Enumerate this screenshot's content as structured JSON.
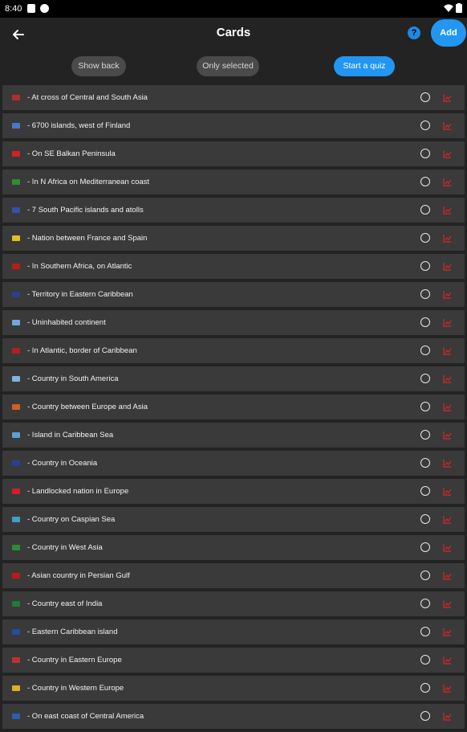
{
  "status": {
    "time": "8:40"
  },
  "header": {
    "title": "Cards",
    "help_label": "?",
    "add_label": "Add"
  },
  "chips": {
    "show_back": "Show back",
    "only_selected": "Only selected",
    "start_quiz": "Start a quiz"
  },
  "colors": {
    "accent": "#2196f3",
    "row_bg": "#3a3a3a",
    "page_bg": "#232323",
    "trend_icon": "#c62828"
  },
  "cards": [
    {
      "text": "- At cross of Central and South Asia",
      "flag_color": "#b02e2e",
      "icon": "flag-icon"
    },
    {
      "text": "- 6700 islands, west of Finland",
      "flag_color": "#4a78c8",
      "icon": "flag-icon"
    },
    {
      "text": "- On SE Balkan Peninsula",
      "flag_color": "#d32020",
      "icon": "flag-icon"
    },
    {
      "text": "- In N Africa on Mediterranean coast",
      "flag_color": "#2e8b3a",
      "icon": "flag-icon"
    },
    {
      "text": "- 7 South Pacific islands and atolls",
      "flag_color": "#3b4fa8",
      "icon": "flag-icon"
    },
    {
      "text": "- Nation between France and Spain",
      "flag_color": "#e0c020",
      "icon": "flag-icon"
    },
    {
      "text": "- In Southern Africa, on Atlantic",
      "flag_color": "#c01818",
      "icon": "flag-icon"
    },
    {
      "text": "- Territory in Eastern Caribbean",
      "flag_color": "#2a3f8f",
      "icon": "flag-icon"
    },
    {
      "text": "- Uninhabited continent",
      "flag_color": "#6fa8dc",
      "icon": "flag-icon"
    },
    {
      "text": "- In Atlantic, border of Caribbean",
      "flag_color": "#b02020",
      "icon": "flag-icon"
    },
    {
      "text": "- Country in South America",
      "flag_color": "#7fb3e6",
      "icon": "flag-icon"
    },
    {
      "text": "- Country between Europe and Asia",
      "flag_color": "#d06020",
      "icon": "flag-icon"
    },
    {
      "text": "- Island in Caribbean Sea",
      "flag_color": "#5aa0d8",
      "icon": "flag-icon"
    },
    {
      "text": "- Country in Oceania",
      "flag_color": "#2a3f8f",
      "icon": "flag-icon"
    },
    {
      "text": "- Landlocked nation in Europe",
      "flag_color": "#d02030",
      "icon": "flag-icon"
    },
    {
      "text": "- Country on Caspian Sea",
      "flag_color": "#3aa0c8",
      "icon": "flag-icon"
    },
    {
      "text": "- Country in West Asia",
      "flag_color": "#2e8b3a",
      "icon": "flag-icon"
    },
    {
      "text": "- Asian country in Persian Gulf",
      "flag_color": "#c01818",
      "icon": "flag-icon"
    },
    {
      "text": "- Country east of India",
      "flag_color": "#1f7a3a",
      "icon": "flag-icon"
    },
    {
      "text": "- Eastern Caribbean island",
      "flag_color": "#2050a0",
      "icon": "flag-icon"
    },
    {
      "text": "- Country in Eastern Europe",
      "flag_color": "#c03030",
      "icon": "flag-icon"
    },
    {
      "text": "- Country in Western Europe",
      "flag_color": "#e0b020",
      "icon": "flag-icon"
    },
    {
      "text": "- On east coast of Central America",
      "flag_color": "#2a5fb0",
      "icon": "flag-icon"
    }
  ]
}
